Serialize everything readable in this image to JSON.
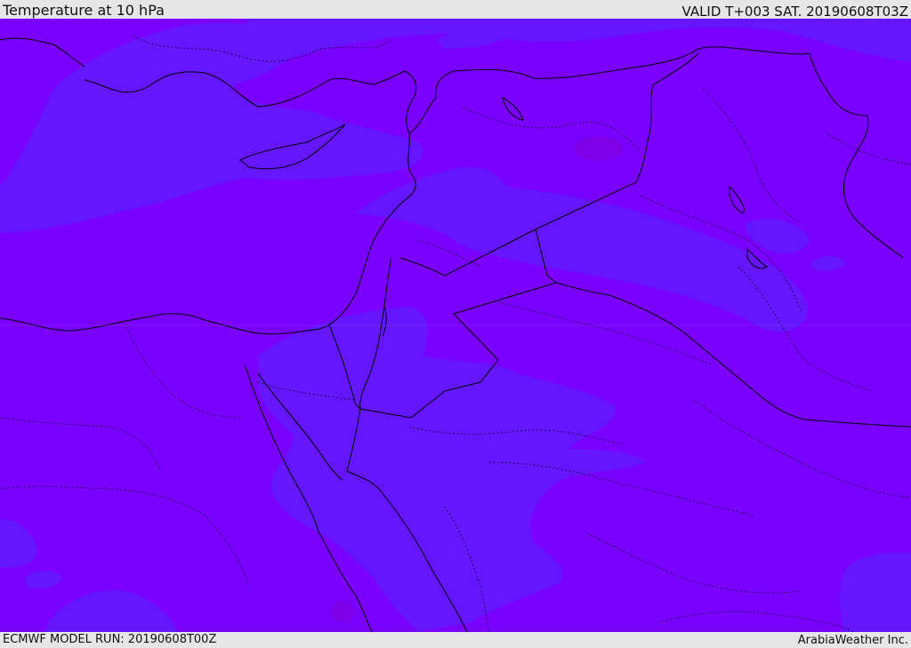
{
  "header": {
    "title": "Temperature at 10 hPa",
    "valid": "VALID T+003 SAT. 20190608T03Z"
  },
  "footer": {
    "model_run": "ECMWF MODEL RUN: 20190608T00Z",
    "credit": "ArabiaWeather Inc."
  },
  "colors": {
    "background_field": "#7a00ff",
    "cooler_field": "#6516ff",
    "warm_spot": "#7d00e6",
    "borders": "#000000"
  }
}
